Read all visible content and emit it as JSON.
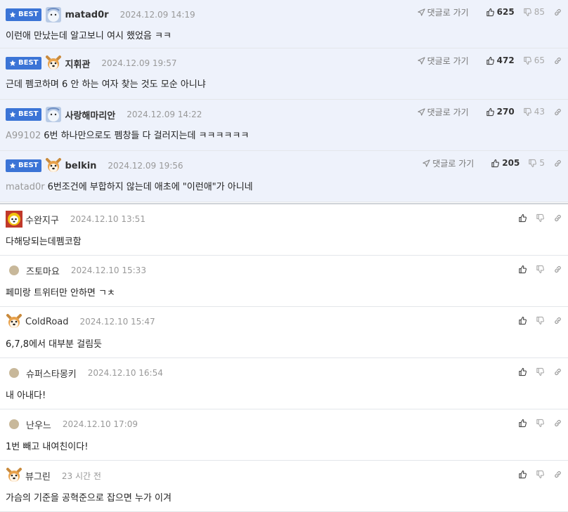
{
  "best_label": "BEST",
  "go_reply_label": "댓글로 가기",
  "best_comments": [
    {
      "nick": "matad0r",
      "date": "2024.12.09 14:19",
      "avatar": "blue-character",
      "reply_to": "",
      "text": "이런애 만났는데 알고보니 여시 했었음 ㅋㅋ",
      "up": "625",
      "down": "85"
    },
    {
      "nick": "지휘관",
      "date": "2024.12.09 19:57",
      "avatar": "dog-face",
      "reply_to": "",
      "text": "근데 펨코하며 6 안 하는 여자 찾는 것도 모순 아니냐",
      "up": "472",
      "down": "65"
    },
    {
      "nick": "사랑해마리안",
      "date": "2024.12.09 14:22",
      "avatar": "blue-character",
      "reply_to": "A99102",
      "text": "6번 하나만으로도 펨창들 다 걸러지는데 ㅋㅋㅋㅋㅋㅋ",
      "up": "270",
      "down": "43"
    },
    {
      "nick": "belkin",
      "date": "2024.12.09 19:56",
      "avatar": "dog-face",
      "reply_to": "matad0r",
      "text": "6번조건에 부합하지 않는데 애초에 \"이런애\"가 아니네",
      "up": "205",
      "down": "5"
    }
  ],
  "comments": [
    {
      "nick": "수완지구",
      "date": "2024.12.10 13:51",
      "avatar": "colorful-character",
      "text": "다해당되는데펨코함"
    },
    {
      "nick": "즈토마요",
      "date": "2024.12.10 15:33",
      "avatar": "dot",
      "text": "페미랑 트위터만 안하면 ㄱㅊ"
    },
    {
      "nick": "ColdRoad",
      "date": "2024.12.10 15:47",
      "avatar": "dog-face",
      "text": "6,7,8에서 대부분 걸림듯"
    },
    {
      "nick": "슈퍼스타몽키",
      "date": "2024.12.10 16:54",
      "avatar": "dot",
      "text": "내 아내다!"
    },
    {
      "nick": "난우느",
      "date": "2024.12.10 17:09",
      "avatar": "dot",
      "text": "1번 빼고 내여친이다!"
    },
    {
      "nick": "뷰그린",
      "date": "23 시간 전",
      "avatar": "dog-face",
      "text": "가슴의 기준을 공혁준으로 잡으면 누가 이겨"
    }
  ],
  "colors": {
    "badge": "#3b74d6",
    "best_bg": "#eef2fb",
    "divider": "#cfd3d8"
  }
}
